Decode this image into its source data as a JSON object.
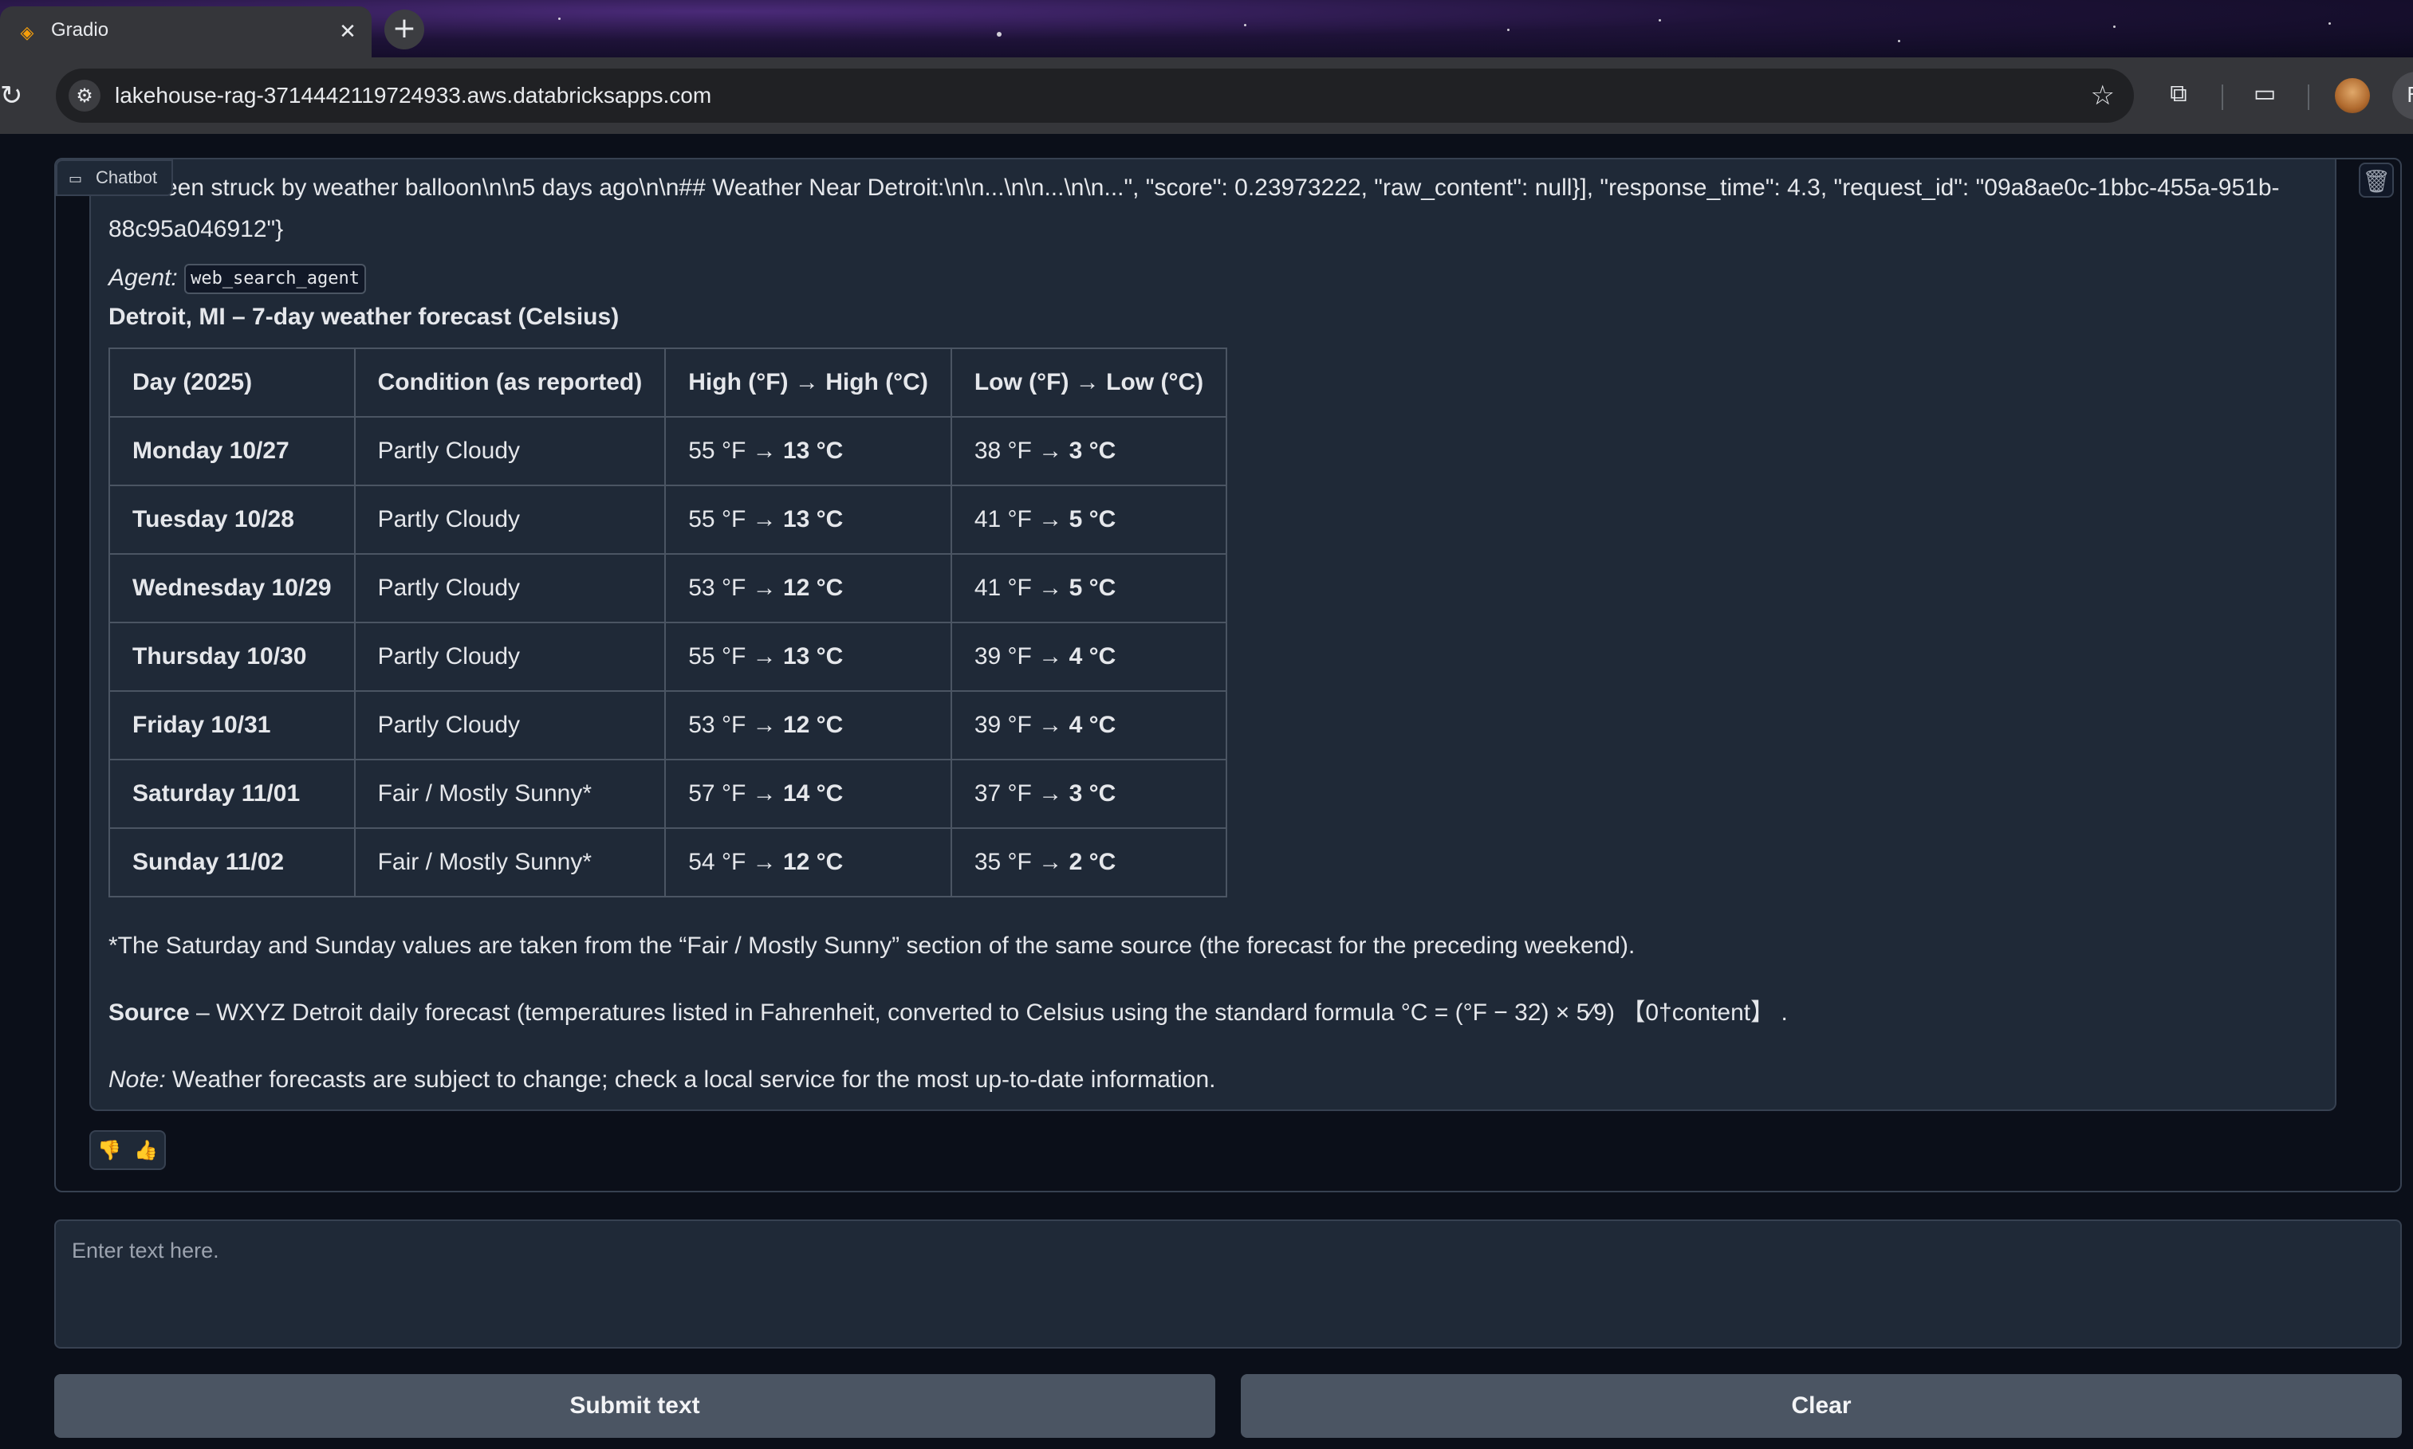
{
  "browser": {
    "tab_title": "Gradio",
    "tab_close": "✕",
    "new_tab": "+",
    "url": "lakehouse-rag-3714442119724933.aws.databricksapps.com",
    "profile_initial": "F"
  },
  "chatbot": {
    "label": "Chatbot",
    "raw_response_line1": "een struck by weather balloon\\n\\n5 days ago\\n\\n## Weather Near Detroit:\\n\\n...\\n\\n...\\n\\n...\", \"score\": 0.23973222, \"raw_content\": null}], \"response_time\": 4.3, \"request_id\": \"09a8ae0c-1bbc-455a-951b-",
    "raw_response_line2": "88c95a046912\"}",
    "agent_prefix": "Agent:",
    "agent_name": "web_search_agent",
    "forecast_title": "Detroit, MI – 7-day weather forecast (Celsius)",
    "table": {
      "headers": [
        "Day (2025)",
        "Condition (as reported)",
        "High (°F) → High (°C)",
        "Low (°F) → Low (°C)"
      ],
      "rows": [
        {
          "day": "Monday 10/27",
          "condition": "Partly Cloudy",
          "high_f": "55 °F →",
          "high_c": "13 °C",
          "low_f": "38 °F →",
          "low_c": "3 °C"
        },
        {
          "day": "Tuesday 10/28",
          "condition": "Partly Cloudy",
          "high_f": "55 °F →",
          "high_c": "13 °C",
          "low_f": "41 °F →",
          "low_c": "5 °C"
        },
        {
          "day": "Wednesday 10/29",
          "condition": "Partly Cloudy",
          "high_f": "53 °F →",
          "high_c": "12 °C",
          "low_f": "41 °F →",
          "low_c": "5 °C"
        },
        {
          "day": "Thursday 10/30",
          "condition": "Partly Cloudy",
          "high_f": "55 °F →",
          "high_c": "13 °C",
          "low_f": "39 °F →",
          "low_c": "4 °C"
        },
        {
          "day": "Friday 10/31",
          "condition": "Partly Cloudy",
          "high_f": "53 °F →",
          "high_c": "12 °C",
          "low_f": "39 °F →",
          "low_c": "4 °C"
        },
        {
          "day": "Saturday 11/01",
          "condition": "Fair / Mostly Sunny*",
          "high_f": "57 °F →",
          "high_c": "14 °C",
          "low_f": "37 °F →",
          "low_c": "3 °C"
        },
        {
          "day": "Sunday 11/02",
          "condition": "Fair / Mostly Sunny*",
          "high_f": "54 °F →",
          "high_c": "12 °C",
          "low_f": "35 °F →",
          "low_c": "2 °C"
        }
      ]
    },
    "footnote": "*The Saturday and Sunday values are taken from the “Fair / Mostly Sunny” section of the same source (the forecast for the preceding weekend).",
    "source_label": "Source",
    "source_text": " – WXYZ Detroit daily forecast (temperatures listed in Fahrenheit, converted to Celsius using the standard formula °C = (°F − 32) × 5⁄9) 【0†content】 .",
    "note_label": "Note:",
    "note_text": " Weather forecasts are subject to change; check a local service for the most up-to-date information."
  },
  "input": {
    "placeholder": "Enter text here.",
    "value": ""
  },
  "buttons": {
    "submit": "Submit text",
    "clear": "Clear"
  },
  "icons": {
    "favicon": "gradio-icon",
    "reload": "reload-icon",
    "site_settings": "tune-icon",
    "bookmark": "star-icon",
    "extensions": "puzzle-icon",
    "cast": "tab-search-icon",
    "chat_label": "chat-bubble-icon",
    "trash": "trash-icon",
    "dislike": "thumbs-down-icon",
    "like": "thumbs-up-icon"
  },
  "colors": {
    "page_bg": "#0b0f19",
    "panel_bg": "#1f2937",
    "border": "#374151",
    "button_bg": "#4b5563",
    "text": "#e5e7eb",
    "placeholder": "#9ca3af"
  }
}
